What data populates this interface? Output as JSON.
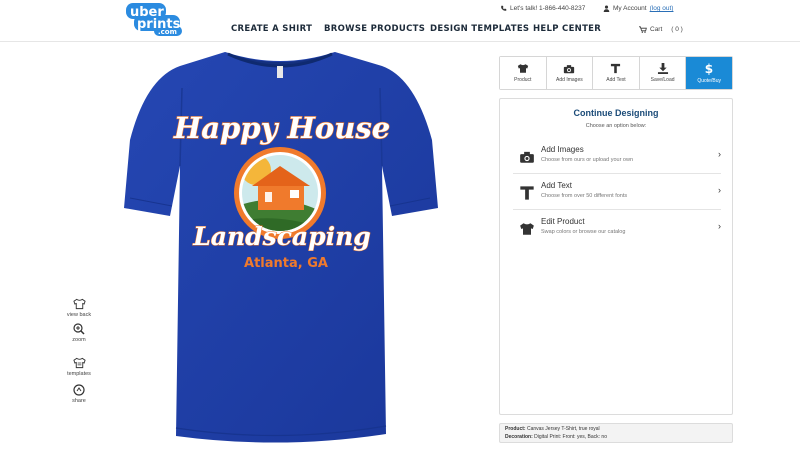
{
  "header": {
    "logo": {
      "line1": "uber",
      "line2": "prints",
      "line3": ".com"
    },
    "nav": [
      "CREATE A SHIRT",
      "BROWSE PRODUCTS",
      "DESIGN TEMPLATES",
      "HELP CENTER"
    ],
    "phone": "Let's talk! 1-866-440-8237",
    "account": "My Account",
    "logout": "(log out)",
    "cart_label": "Cart",
    "cart_count": "( 0 )"
  },
  "design": {
    "line1": "Happy House",
    "line2": "Landscaping",
    "line3": "Atlanta, GA",
    "shirt_color": "#1f3fa6",
    "accent_orange": "#f07a2c"
  },
  "side_tools": [
    "view back",
    "zoom",
    "templates",
    "share"
  ],
  "toolbar": {
    "items": [
      {
        "label": "Product",
        "icon": "tshirt-icon"
      },
      {
        "label": "Add Images",
        "icon": "camera-icon"
      },
      {
        "label": "Add Text",
        "icon": "text-icon"
      },
      {
        "label": "Save/Load",
        "icon": "download-icon"
      },
      {
        "label": "Quote/Buy",
        "icon": "dollar-icon"
      }
    ],
    "accent": "#1a8ad6"
  },
  "panel": {
    "title": "Continue Designing",
    "subtitle": "Choose an option below:",
    "options": [
      {
        "title": "Add Images",
        "desc": "Choose from ours or upload your own"
      },
      {
        "title": "Add Text",
        "desc": "Choose from over 50 different fonts"
      },
      {
        "title": "Edit Product",
        "desc": "Swap colors or browse our catalog"
      }
    ]
  },
  "product_info": {
    "product_label": "Product:",
    "product_value": "Canvas Jersey T-Shirt, true royal",
    "decoration_label": "Decoration:",
    "decoration_value": "Digital Print: Front: yes, Back: no"
  }
}
